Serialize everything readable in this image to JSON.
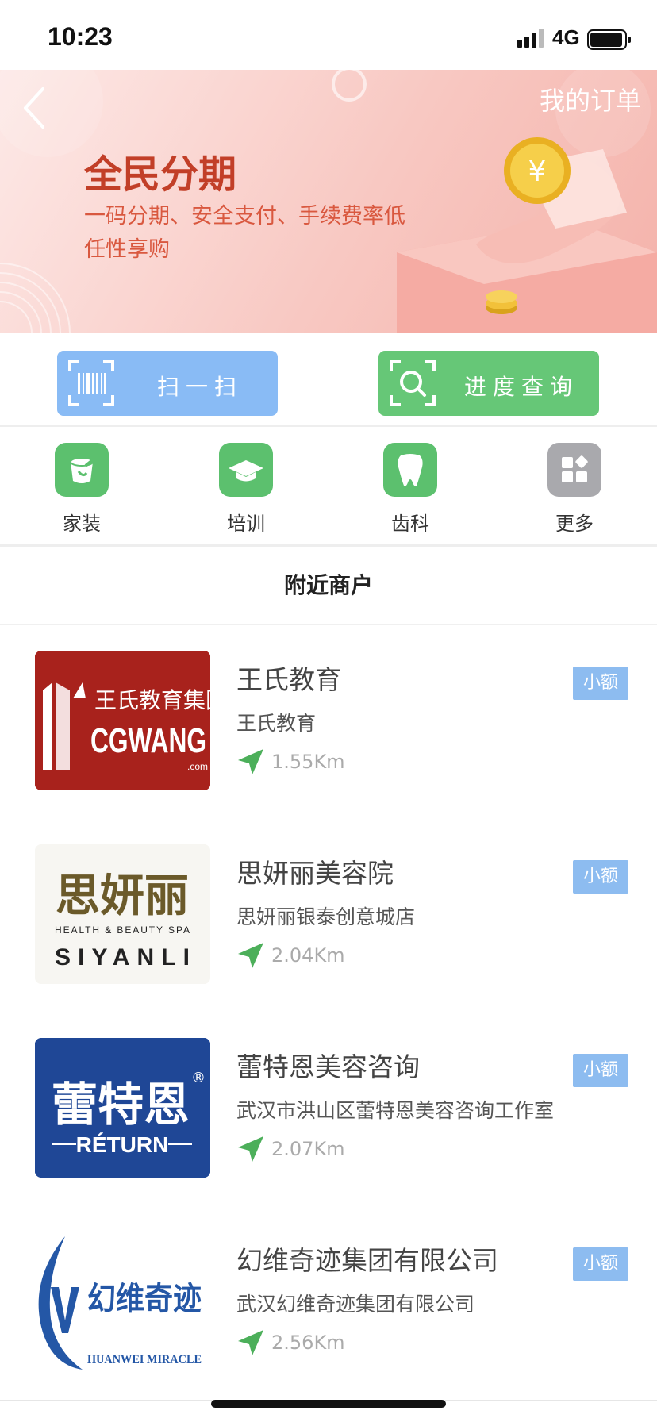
{
  "status_bar": {
    "time": "10:23",
    "network": "4G"
  },
  "banner": {
    "back_icon": "chevron-left-icon",
    "my_orders": "我的订单",
    "title": "全民分期",
    "subtitle_line1": "一码分期、安全支付、手续费率低",
    "subtitle_line2": "任性享购",
    "coin_symbol": "¥"
  },
  "actions": {
    "scan": {
      "label": "扫一扫",
      "icon": "barcode-scan-icon",
      "color": "#89bbf5"
    },
    "progress": {
      "label": "进度查询",
      "icon": "search-magnifier-icon",
      "color": "#66c777"
    }
  },
  "categories": [
    {
      "label": "家装",
      "icon": "paint-bucket-icon",
      "color": "#5cc06e"
    },
    {
      "label": "培训",
      "icon": "graduation-cap-icon",
      "color": "#5cc06e"
    },
    {
      "label": "齿科",
      "icon": "tooth-icon",
      "color": "#5cc06e"
    },
    {
      "label": "更多",
      "icon": "grid-more-icon",
      "color": "#a9a9ad"
    }
  ],
  "nearby": {
    "title": "附近商户",
    "merchants": [
      {
        "name": "王氏教育",
        "branch": "王氏教育",
        "distance": "1.55Km",
        "badge": "小额",
        "logo": {
          "line1": "王氏教育集团",
          "line2": "CGWANG",
          "line3": ".com"
        }
      },
      {
        "name": "思妍丽美容院",
        "branch": "思妍丽银泰创意城店",
        "distance": "2.04Km",
        "badge": "小额",
        "logo": {
          "line1": "思妍丽",
          "line2": "HEALTH & BEAUTY SPA",
          "line3": "SIYANLI"
        }
      },
      {
        "name": "蕾特恩美容咨询",
        "branch": "武汉市洪山区蕾特恩美容咨询工作室",
        "distance": "2.07Km",
        "badge": "小额",
        "logo": {
          "line1": "蕾特恩",
          "line2": "RÉTURN",
          "line3": "®"
        }
      },
      {
        "name": "幻维奇迹集团有限公司",
        "branch": "武汉幻维奇迹集团有限公司",
        "distance": "2.56Km",
        "badge": "小额",
        "logo": {
          "line1": "幻维奇迹",
          "line2": "HUANWEI MIRACLE"
        }
      }
    ]
  }
}
